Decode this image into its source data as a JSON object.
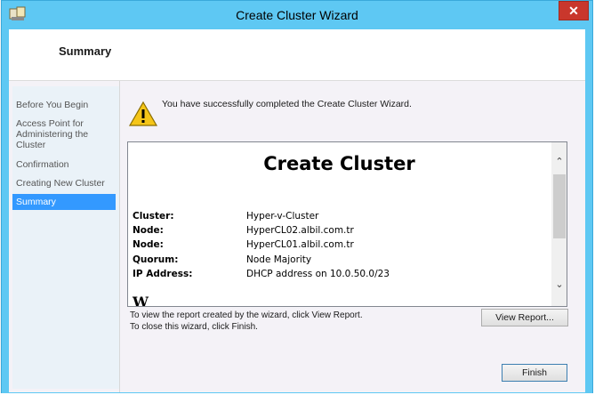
{
  "window": {
    "title": "Create Cluster Wizard",
    "close_glyph": "✕"
  },
  "header": {
    "page_title": "Summary"
  },
  "nav": {
    "items": [
      {
        "label": "Before You Begin"
      },
      {
        "label": "Access Point for Administering the Cluster"
      },
      {
        "label": "Confirmation"
      },
      {
        "label": "Creating New Cluster"
      },
      {
        "label": "Summary"
      }
    ],
    "active": "Summary"
  },
  "main": {
    "success_message": "You have successfully completed the Create Cluster Wizard.",
    "report": {
      "title": "Create Cluster",
      "rows": [
        {
          "label": "Cluster:",
          "value": "Hyper-v-Cluster"
        },
        {
          "label": "Node:",
          "value": "HyperCL02.albil.com.tr"
        },
        {
          "label": "Node:",
          "value": "HyperCL01.albil.com.tr"
        },
        {
          "label": "Quorum:",
          "value": "Node Majority"
        },
        {
          "label": "IP Address:",
          "value": "DHCP address on 10.0.50.0/23"
        }
      ],
      "next_heading_partial": "W",
      "scroll_up_glyph": "⌃",
      "scroll_down_glyph": "⌄"
    },
    "hint_line_1": "To view the report created by the wizard, click View Report.",
    "hint_line_2": "To close this wizard, click Finish."
  },
  "buttons": {
    "view_report": "View Report...",
    "finish": "Finish"
  },
  "colors": {
    "titlebar": "#5ec8f3",
    "close": "#c9372c",
    "nav_active": "#3399ff",
    "warning": "#f5c518"
  }
}
